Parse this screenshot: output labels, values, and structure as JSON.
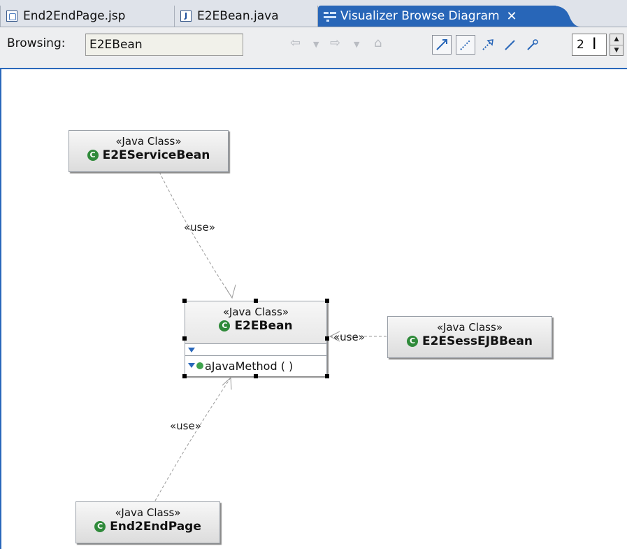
{
  "tabs": [
    {
      "label": "End2EndPage.jsp",
      "icon": "jsp-file-icon"
    },
    {
      "label": "E2EBean.java",
      "icon": "java-file-icon"
    },
    {
      "label": "Visualizer Browse Diagram",
      "icon": "visualizer-diagram-icon",
      "active": true
    }
  ],
  "toolbar": {
    "browsing_label": "Browsing:",
    "browsing_value": "E2EBean",
    "depth_value": "2"
  },
  "diagram": {
    "nodes": [
      {
        "id": "E2EServiceBean",
        "stereotype": "«Java Class»",
        "name": "E2EServiceBean"
      },
      {
        "id": "E2EBean",
        "stereotype": "«Java Class»",
        "name": "E2EBean",
        "method": "aJavaMethod ( )"
      },
      {
        "id": "E2ESessEJBBean",
        "stereotype": "«Java Class»",
        "name": "E2ESessEJBBean"
      },
      {
        "id": "End2EndPage",
        "stereotype": "«Java Class»",
        "name": "End2EndPage"
      }
    ],
    "edges": [
      {
        "from": "E2EServiceBean",
        "to": "E2EBean",
        "label": "«use»"
      },
      {
        "from": "E2ESessEJBBean",
        "to": "E2EBean",
        "label": "«use»"
      },
      {
        "from": "End2EndPage",
        "to": "E2EBean",
        "label": "«use»"
      }
    ]
  },
  "colors": {
    "accent": "#2866b8",
    "class_icon": "#2f8a3a",
    "method_icon": "#3fa34d"
  }
}
